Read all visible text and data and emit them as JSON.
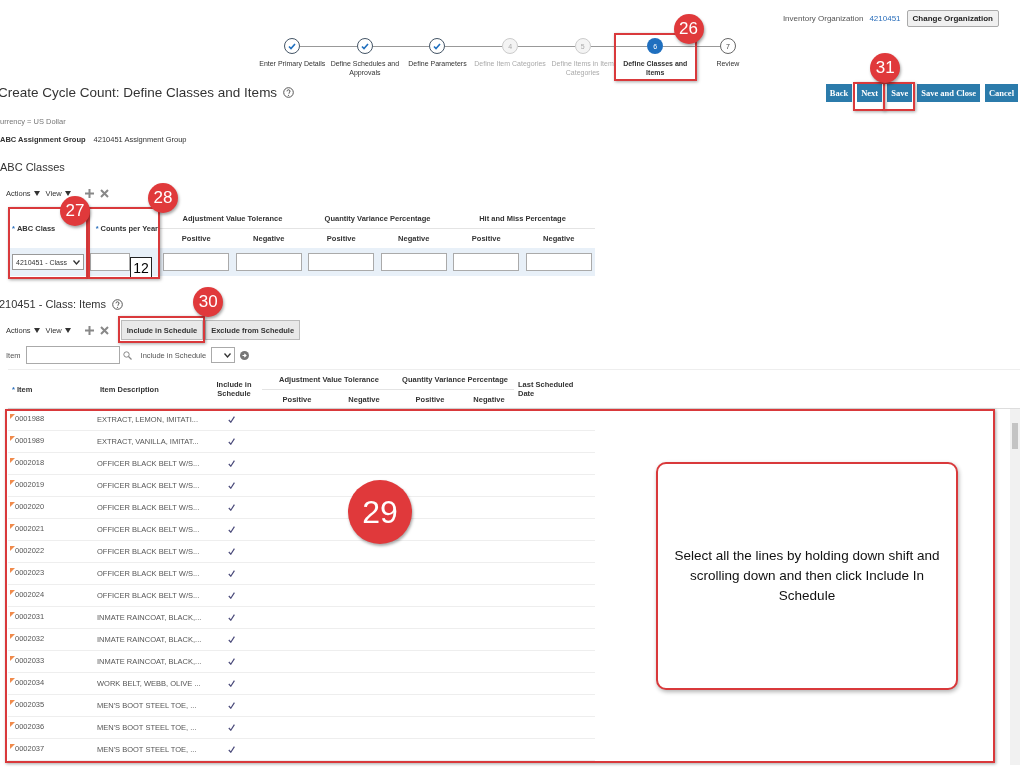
{
  "header": {
    "org_label": "Inventory Organization",
    "org_value": "4210451",
    "change_button": "Change Organization"
  },
  "train": [
    {
      "label": "Enter Primary Details",
      "kind": "done"
    },
    {
      "label": "Define Schedules and Approvals",
      "kind": "done"
    },
    {
      "label": "Define Parameters",
      "kind": "done"
    },
    {
      "label": "Define Item Categories",
      "number": "4",
      "kind": "disabled"
    },
    {
      "label": "Define Items in Item Categories",
      "number": "5",
      "kind": "disabled"
    },
    {
      "label": "Define Classes and Items",
      "number": "6",
      "kind": "current",
      "highlighted": true,
      "callout": "26"
    },
    {
      "label": "Review",
      "number": "7",
      "kind": "pending"
    }
  ],
  "title": "Create Cycle Count: Define Classes and Items",
  "buttons": [
    {
      "label": "Back",
      "highlighted": false
    },
    {
      "label": "Next",
      "highlighted": true,
      "callout": "31"
    },
    {
      "label": "Save",
      "highlighted": true
    },
    {
      "label": "Save and Close",
      "highlighted": false
    },
    {
      "label": "Cancel",
      "highlighted": false
    }
  ],
  "currency": "urrency = US Dollar",
  "assignment_group": {
    "label": "ABC Assignment Group",
    "value": "4210451 Assignment Group"
  },
  "abc_classes": {
    "title": "ABC Classes",
    "toolbar": {
      "actions": "Actions",
      "view": "View"
    },
    "class_column": {
      "label": "ABC Class",
      "required_mark": "*",
      "highlighted": true,
      "callout": "27"
    },
    "counts_column": {
      "label": "Counts per Year",
      "required_mark": "*",
      "highlighted": true,
      "callout": "28"
    },
    "groups": [
      {
        "label": "Adjustment Value Tolerance",
        "columns": [
          "Positive",
          "Negative"
        ]
      },
      {
        "label": "Quantity Variance Percentage",
        "columns": [
          "Positive",
          "Negative"
        ]
      },
      {
        "label": "Hit and Miss Percentage",
        "columns": [
          "Positive",
          "Negative"
        ]
      }
    ],
    "row": {
      "abc_class": "4210451 - Class",
      "counts_annotation": "12"
    }
  },
  "class_items": {
    "title": "210451 - Class: Items",
    "toolbar": {
      "actions": "Actions",
      "view": "View",
      "buttons": [
        {
          "label": "Include in Schedule",
          "highlighted": true,
          "callout": "30"
        },
        {
          "label": "Exclude from Schedule",
          "highlighted": false
        }
      ]
    },
    "filters": {
      "item_label": "Item",
      "include_label": "Include in Schedule"
    },
    "columns": {
      "item": "Item",
      "item_required_mark": "*",
      "description": "Item Description",
      "include": "Include in Schedule",
      "groups": [
        {
          "label": "Adjustment Value Tolerance",
          "columns": [
            "Positive",
            "Negative"
          ]
        },
        {
          "label": "Quantity Variance Percentage",
          "columns": [
            "Positive",
            "Negative"
          ]
        }
      ],
      "last_scheduled": "Last Scheduled Date"
    },
    "rows_highlighted": true,
    "rows_callout": "29",
    "rows": [
      {
        "item": "0001988",
        "description": "EXTRACT, LEMON, IMITATI...",
        "included": true
      },
      {
        "item": "0001989",
        "description": "EXTRACT, VANILLA, IMITAT...",
        "included": true
      },
      {
        "item": "0002018",
        "description": "OFFICER BLACK BELT W/S...",
        "included": true
      },
      {
        "item": "0002019",
        "description": "OFFICER BLACK BELT W/S...",
        "included": true
      },
      {
        "item": "0002020",
        "description": "OFFICER BLACK BELT W/S...",
        "included": true
      },
      {
        "item": "0002021",
        "description": "OFFICER BLACK BELT W/S...",
        "included": true
      },
      {
        "item": "0002022",
        "description": "OFFICER BLACK BELT W/S...",
        "included": true
      },
      {
        "item": "0002023",
        "description": "OFFICER BLACK BELT W/S...",
        "included": true
      },
      {
        "item": "0002024",
        "description": "OFFICER BLACK BELT W/S...",
        "included": true
      },
      {
        "item": "0002031",
        "description": "INMATE RAINCOAT, BLACK,...",
        "included": true
      },
      {
        "item": "0002032",
        "description": "INMATE RAINCOAT, BLACK,...",
        "included": true
      },
      {
        "item": "0002033",
        "description": "INMATE RAINCOAT, BLACK,...",
        "included": true
      },
      {
        "item": "0002034",
        "description": "WORK BELT, WEBB, OLIVE ...",
        "included": true
      },
      {
        "item": "0002035",
        "description": "MEN'S BOOT STEEL TOE, ...",
        "included": true
      },
      {
        "item": "0002036",
        "description": "MEN'S BOOT STEEL TOE, ...",
        "included": true
      },
      {
        "item": "0002037",
        "description": "MEN'S BOOT STEEL TOE, ...",
        "included": true
      }
    ]
  },
  "note": "Select all the lines by holding down shift and scrolling down and then click Include In Schedule"
}
